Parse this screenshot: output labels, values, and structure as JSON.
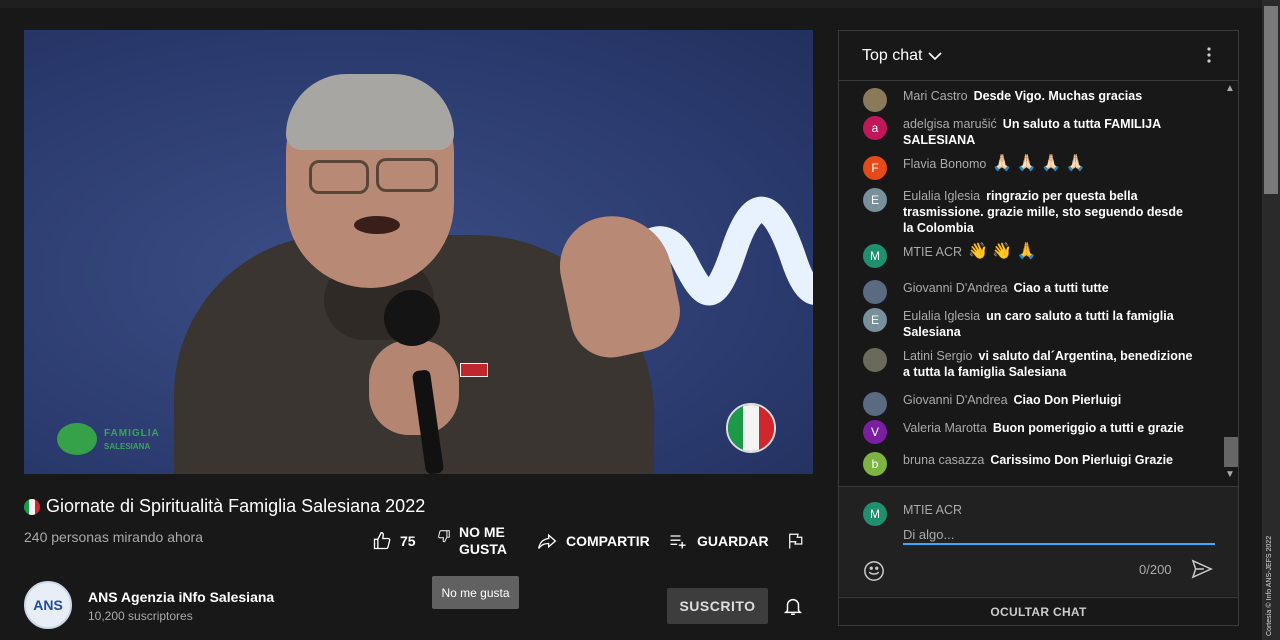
{
  "video": {
    "logo_line1": "FAMIGLIA",
    "logo_line2": "SALESIANA"
  },
  "title_bar": {
    "title": "Giornate di Spiritualità Famiglia Salesiana 2022",
    "viewers": "240 personas mirando ahora"
  },
  "actions": {
    "like_count": "75",
    "dislike_line1": "NO ME",
    "dislike_line2": "GUSTA",
    "share_label": "COMPARTIR",
    "save_label": "GUARDAR",
    "tooltip": "No me gusta"
  },
  "channel": {
    "avatar_text": "ANS",
    "name": "ANS Agenzia iNfo Salesiana",
    "subscribers": "10,200 suscriptores",
    "subscribe_label": "SUSCRITO"
  },
  "chat": {
    "title": "Top chat",
    "messages": [
      {
        "author": "Mari Castro",
        "text": "Desde Vigo. Muchas gracias",
        "initial": "",
        "color": "#8a7a5a"
      },
      {
        "author": "adelgisa marušić",
        "text": "Un saluto a tutta FAMILIJA SALESIANA",
        "initial": "a",
        "color": "#c2185b"
      },
      {
        "author": "Flavia Bonomo",
        "text": "🙏🏻 🙏🏻 🙏🏻 🙏🏻",
        "initial": "F",
        "color": "#e64a19"
      },
      {
        "author": "Eulalia Iglesia",
        "text": "ringrazio per questa bella trasmissione. grazie mille, sto seguendo desde la Colombia",
        "initial": "E",
        "color": "#78909c"
      },
      {
        "author": "MTIE ACR",
        "text": "👋 👋 🙏",
        "initial": "M",
        "color": "#1f8f6e"
      },
      {
        "author": "Giovanni D'Andrea",
        "text": "Ciao a tutti tutte",
        "initial": "",
        "color": "#5a6a80"
      },
      {
        "author": "Eulalia Iglesia",
        "text": "un caro saluto a tutti la famiglia Salesiana",
        "initial": "E",
        "color": "#78909c"
      },
      {
        "author": "Latini Sergio",
        "text": "vi saluto dal´Argentina, benedizione a tutta la famiglia Salesiana",
        "initial": "",
        "color": "#6a6a5a"
      },
      {
        "author": "Giovanni D'Andrea",
        "text": "Ciao Don Pierluigi",
        "initial": "",
        "color": "#5a6a80"
      },
      {
        "author": "Valeria Marotta",
        "text": "Buon pomeriggio a tutti e grazie",
        "initial": "V",
        "color": "#7b1fa2"
      },
      {
        "author": "bruna casazza",
        "text": "Carissimo Don Pierluigi Grazie",
        "initial": "b",
        "color": "#7cb342"
      }
    ],
    "composer": {
      "initial": "M",
      "name": "MTIE ACR",
      "placeholder": "Di algo...",
      "counter": "0/200"
    },
    "hide_label": "OCULTAR CHAT"
  },
  "credit": "Cortesía © Info ANS-JEFS 2022"
}
